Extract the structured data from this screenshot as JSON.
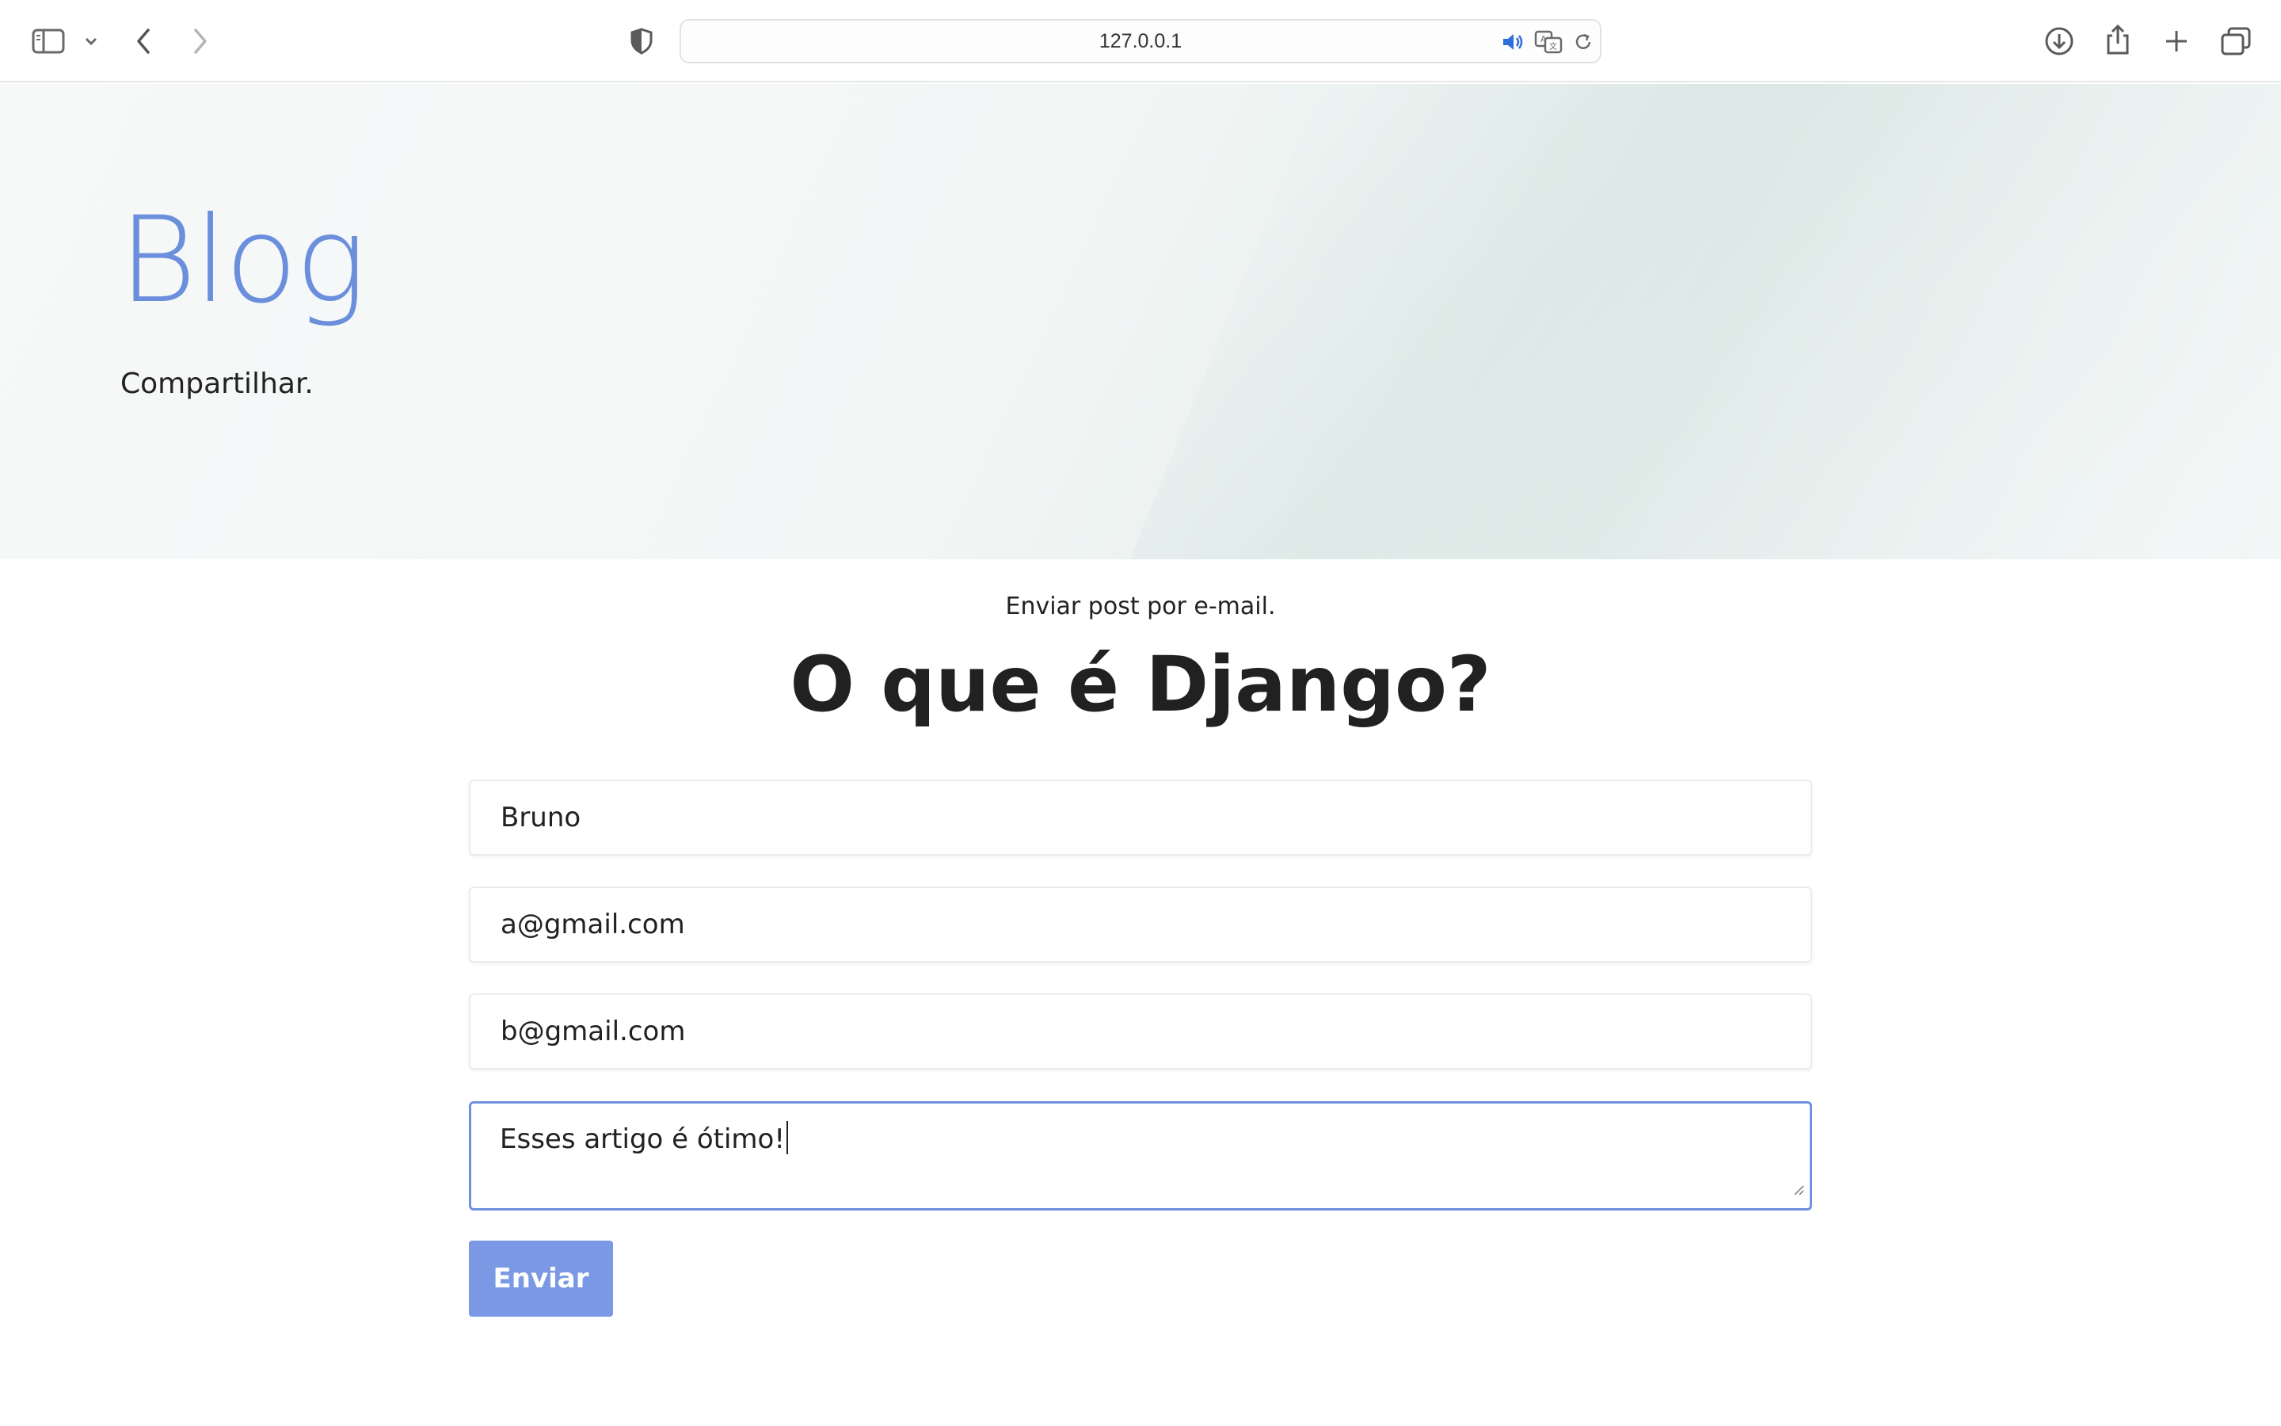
{
  "browser": {
    "url": "127.0.0.1",
    "icons": {
      "sidebar": "sidebar-icon",
      "sidebar_menu": "chevron-down-icon",
      "back": "chevron-left-icon",
      "forward": "chevron-right-icon",
      "privacy": "shield-icon",
      "audio": "speaker-icon",
      "translate": "translate-icon",
      "reload": "reload-icon",
      "downloads": "download-icon",
      "share": "share-icon",
      "new_tab": "plus-icon",
      "tabs": "tab-overview-icon"
    }
  },
  "hero": {
    "title": "Blog",
    "subtitle": "Compartilhar."
  },
  "main": {
    "intro": "Enviar post por e-mail.",
    "post_title": "O que é Django?"
  },
  "form": {
    "name_value": "Bruno",
    "email_value": "a@gmail.com",
    "to_value": "b@gmail.com",
    "comments_value": "Esses artigo é ótimo!",
    "submit_label": "Enviar"
  },
  "colors": {
    "accent": "#6b8fdc",
    "button": "#7a98e3",
    "focus_border": "#6f8fe0",
    "text": "#212121"
  }
}
